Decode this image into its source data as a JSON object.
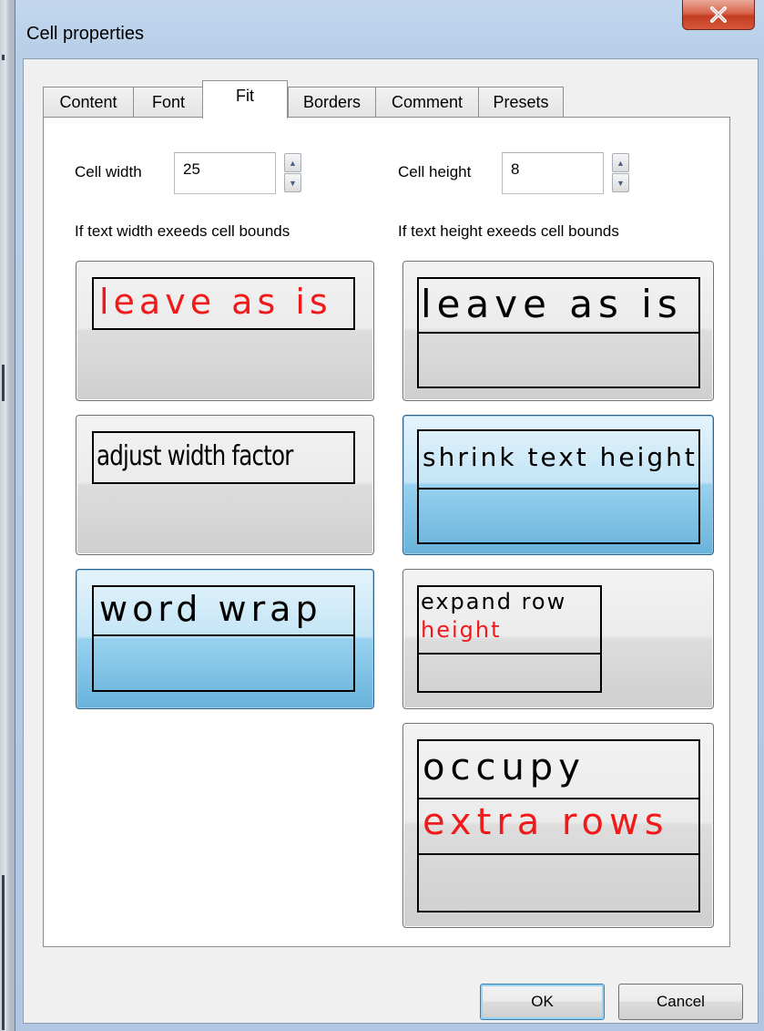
{
  "window": {
    "title": "Cell properties",
    "close_glyph": "X"
  },
  "tabs": [
    {
      "label": "Content",
      "active": false
    },
    {
      "label": "Font",
      "active": false
    },
    {
      "label": "Fit",
      "active": true
    },
    {
      "label": "Borders",
      "active": false
    },
    {
      "label": "Comment",
      "active": false
    },
    {
      "label": "Presets",
      "active": false
    }
  ],
  "fit": {
    "cell_width": {
      "label": "Cell width",
      "value": "25"
    },
    "cell_height": {
      "label": "Cell height",
      "value": "8"
    },
    "width_heading": "If text width exeeds cell bounds",
    "height_heading": "If text height exeeds cell bounds",
    "width_options": {
      "leave": "leave as is",
      "adjust": "adjust width factor",
      "wrap": "word wrap"
    },
    "height_options": {
      "leave": "leave as is",
      "shrink": "shrink text height",
      "expand_line1": "expand row",
      "expand_line2": "height",
      "occupy_line1": "occupy",
      "occupy_line2": "extra rows"
    },
    "selected_width_option": "word wrap",
    "selected_height_option": "shrink text height"
  },
  "buttons": {
    "ok": "OK",
    "cancel": "Cancel"
  },
  "colors": {
    "highlight_text": "#f01a1a",
    "selected_option": "#98d1ef"
  }
}
